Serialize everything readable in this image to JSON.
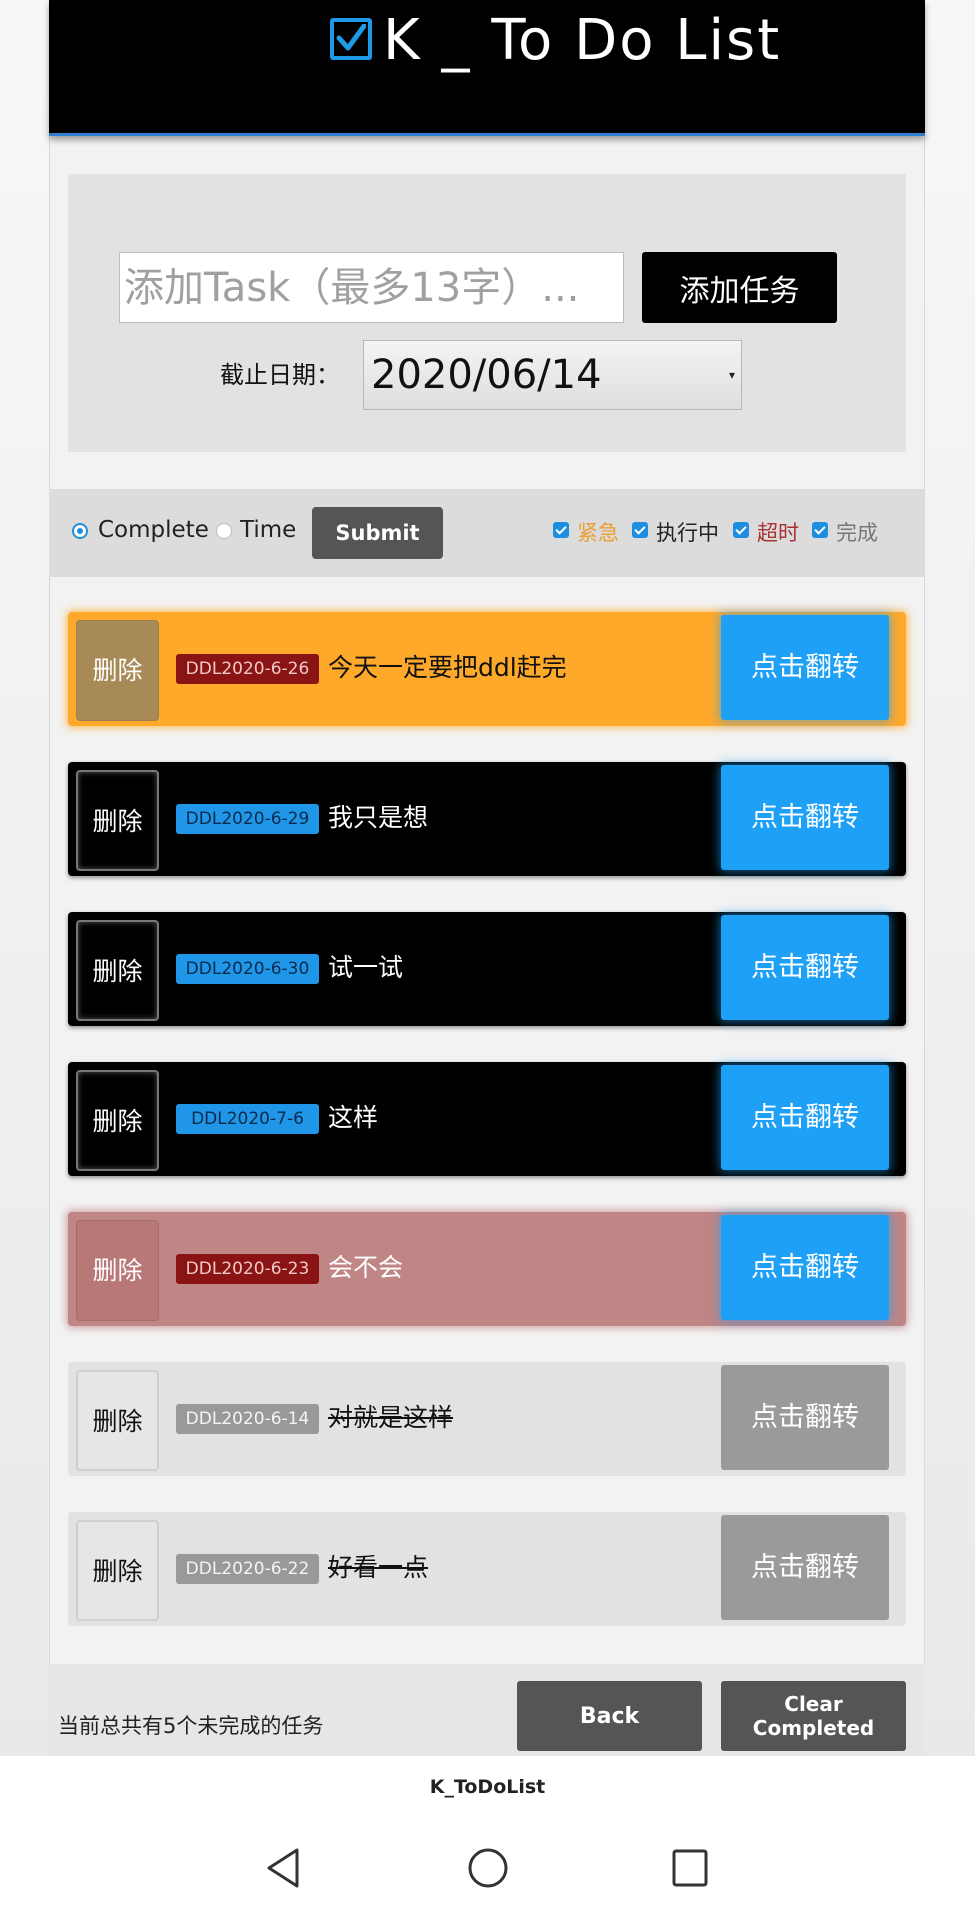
{
  "header": {
    "title": "K _ To Do List",
    "icon": "checked-box-icon"
  },
  "add_panel": {
    "input_placeholder": "添加Task（最多13字）...",
    "add_button": "添加任务",
    "deadline_label": "截止日期：",
    "date_value": "2020/06/14"
  },
  "filter_bar": {
    "sort_options": [
      {
        "label": "Complete",
        "selected": true
      },
      {
        "label": "Time",
        "selected": false
      }
    ],
    "submit": "Submit",
    "filters": [
      {
        "label": "紧急",
        "checked": true,
        "color": "#e8a030"
      },
      {
        "label": "执行中",
        "checked": true,
        "color": "#222222"
      },
      {
        "label": "超时",
        "checked": true,
        "color": "#a83232"
      },
      {
        "label": "完成",
        "checked": true,
        "color": "#777777"
      }
    ]
  },
  "tasks": [
    {
      "delete": "删除",
      "ddl": "DDL2020-6-26",
      "text": "今天一定要把ddl赶完",
      "flip": "点击翻转",
      "status": "urgent"
    },
    {
      "delete": "删除",
      "ddl": "DDL2020-6-29",
      "text": "我只是想",
      "flip": "点击翻转",
      "status": "active"
    },
    {
      "delete": "删除",
      "ddl": "DDL2020-6-30",
      "text": "试一试",
      "flip": "点击翻转",
      "status": "active"
    },
    {
      "delete": "删除",
      "ddl": "DDL2020-7-6",
      "text": "这样",
      "flip": "点击翻转",
      "status": "active"
    },
    {
      "delete": "删除",
      "ddl": "DDL2020-6-23",
      "text": "会不会",
      "flip": "点击翻转",
      "status": "overdue"
    },
    {
      "delete": "删除",
      "ddl": "DDL2020-6-14",
      "text": "对就是这样",
      "flip": "点击翻转",
      "status": "done"
    },
    {
      "delete": "删除",
      "ddl": "DDL2020-6-22",
      "text": "好看一点",
      "flip": "点击翻转",
      "status": "done"
    }
  ],
  "footer": {
    "count_text": "当前总共有5个未完成的任务",
    "back": "Back",
    "clear_completed": "Clear Completed"
  },
  "system": {
    "app_name": "K_ToDoList",
    "nav_icons": [
      "back-triangle-icon",
      "home-circle-icon",
      "recents-square-icon"
    ]
  },
  "colors": {
    "urgent": "#ffa92b",
    "active": "#000000",
    "overdue": "#c08585",
    "done": "#e2e2e2",
    "accent_blue": "#1ea0f7"
  }
}
